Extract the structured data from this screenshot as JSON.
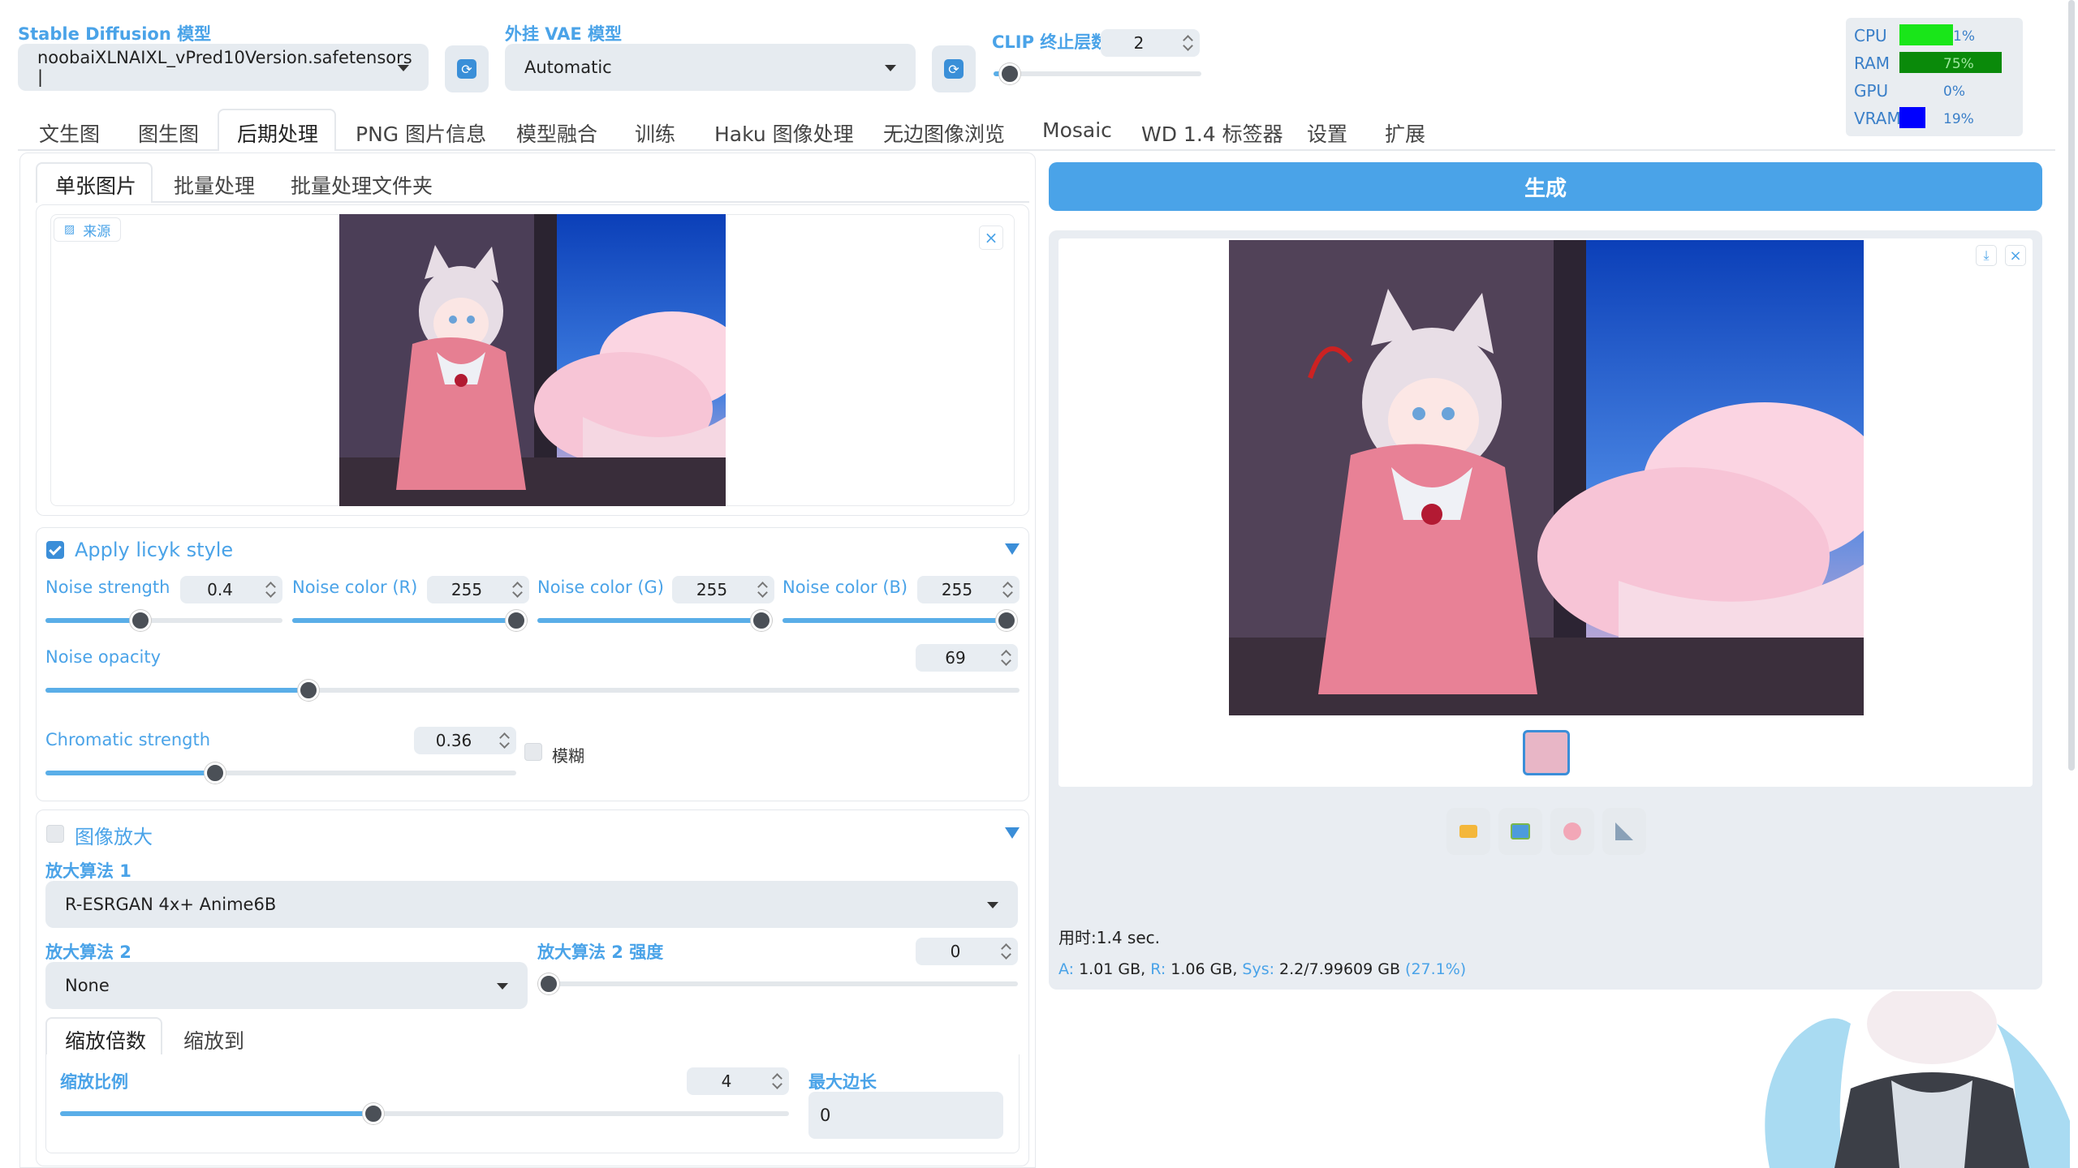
{
  "header": {
    "sd_model_label": "Stable Diffusion 模型",
    "sd_model_value": "noobaiXLNAIXL_vPred10Version.safetensors |",
    "vae_label": "外挂 VAE 模型",
    "vae_value": "Automatic",
    "clip_label": "CLIP 终止层数",
    "clip_value": "2",
    "clip_slider_fraction": 0.08
  },
  "monitor": {
    "cpu_label": "CPU",
    "cpu_value": "1%",
    "cpu_color": "#19e619",
    "cpu_fraction": 0.01,
    "ram_label": "RAM",
    "ram_value": "75%",
    "ram_color": "#0a8a0a",
    "ram_fraction": 0.75,
    "gpu_label": "GPU",
    "gpu_value": "0%",
    "gpu_fraction": 0.0,
    "vram_label": "VRAM",
    "vram_value": "19%",
    "vram_color": "#0000ff",
    "vram_fraction": 0.19
  },
  "main_tabs": [
    "文生图",
    "图生图",
    "后期处理",
    "PNG 图片信息",
    "模型融合",
    "训练",
    "Haku 图像处理",
    "无边图像浏览",
    "Mosaic",
    "WD 1.4 标签器",
    "设置",
    "扩展"
  ],
  "main_tab_selected": "后期处理",
  "sub_tabs": [
    "单张图片",
    "批量处理",
    "批量处理文件夹"
  ],
  "source_label": "来源",
  "generate_label": "生成",
  "licyk": {
    "title": "Apply licyk style",
    "checked": true,
    "noise_strength_label": "Noise strength",
    "noise_strength_value": "0.4",
    "noise_strength_fraction": 0.4,
    "noise_r_label": "Noise color (R)",
    "noise_r_value": "255",
    "noise_r_fraction": 1.0,
    "noise_g_label": "Noise color (G)",
    "noise_g_value": "255",
    "noise_g_fraction": 1.0,
    "noise_b_label": "Noise color (B)",
    "noise_b_value": "255",
    "noise_b_fraction": 1.0,
    "noise_opacity_label": "Noise opacity",
    "noise_opacity_value": "69",
    "noise_opacity_fraction": 0.27,
    "chromatic_label": "Chromatic strength",
    "chromatic_value": "0.36",
    "chromatic_fraction": 0.36,
    "blur_label": "模糊"
  },
  "upscale": {
    "title": "图像放大",
    "checked": false,
    "upscaler1_label": "放大算法 1",
    "upscaler1_value": "R-ESRGAN 4x+ Anime6B",
    "upscaler2_label": "放大算法 2",
    "upscaler2_value": "None",
    "upscaler2_strength_label": "放大算法 2 强度",
    "upscaler2_strength_value": "0",
    "upscaler2_strength_fraction": 0.0,
    "resize_tabs": [
      "缩放倍数",
      "缩放到"
    ],
    "scale_label": "缩放比例",
    "scale_value": "4",
    "scale_fraction": 0.43,
    "max_side_label": "最大边长",
    "max_side_value": "0"
  },
  "output": {
    "time_text": "用时:1.4 sec.",
    "mem_a_label": "A:",
    "mem_a_value": "1.01 GB,",
    "mem_r_label": "R:",
    "mem_r_value": "1.06 GB,",
    "mem_sys_label": "Sys:",
    "mem_sys_value": "2.2/7.99609 GB",
    "mem_pct": "(27.1%)"
  },
  "colors": {
    "accent": "#4aa3e8",
    "generate": "#4aa3e8"
  }
}
